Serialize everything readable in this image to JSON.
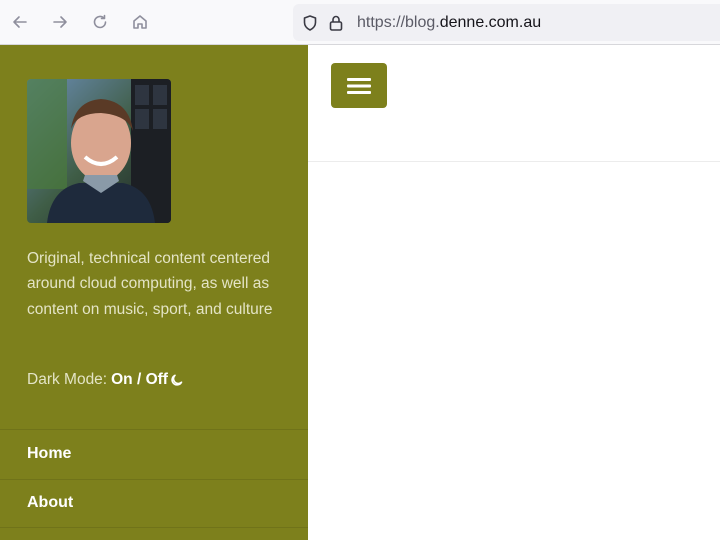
{
  "browser": {
    "url_scheme": "https://blog.",
    "url_domain": "denne.com.au"
  },
  "sidebar": {
    "description": "Original, technical content centered around cloud computing, as well as content on music, sport, and culture",
    "dark_mode_label": "Dark Mode:",
    "dark_mode_toggle": "On / Off",
    "nav": [
      {
        "label": "Home"
      },
      {
        "label": "About"
      }
    ]
  },
  "colors": {
    "accent": "#7d801c",
    "sidebar_text": "#e4e4c6"
  },
  "icons": {
    "back": "arrow-left-icon",
    "forward": "arrow-right-icon",
    "reload": "reload-icon",
    "home": "home-icon",
    "shield": "shield-icon",
    "lock": "lock-icon",
    "moon": "moon-icon",
    "menu": "hamburger-menu-icon"
  }
}
